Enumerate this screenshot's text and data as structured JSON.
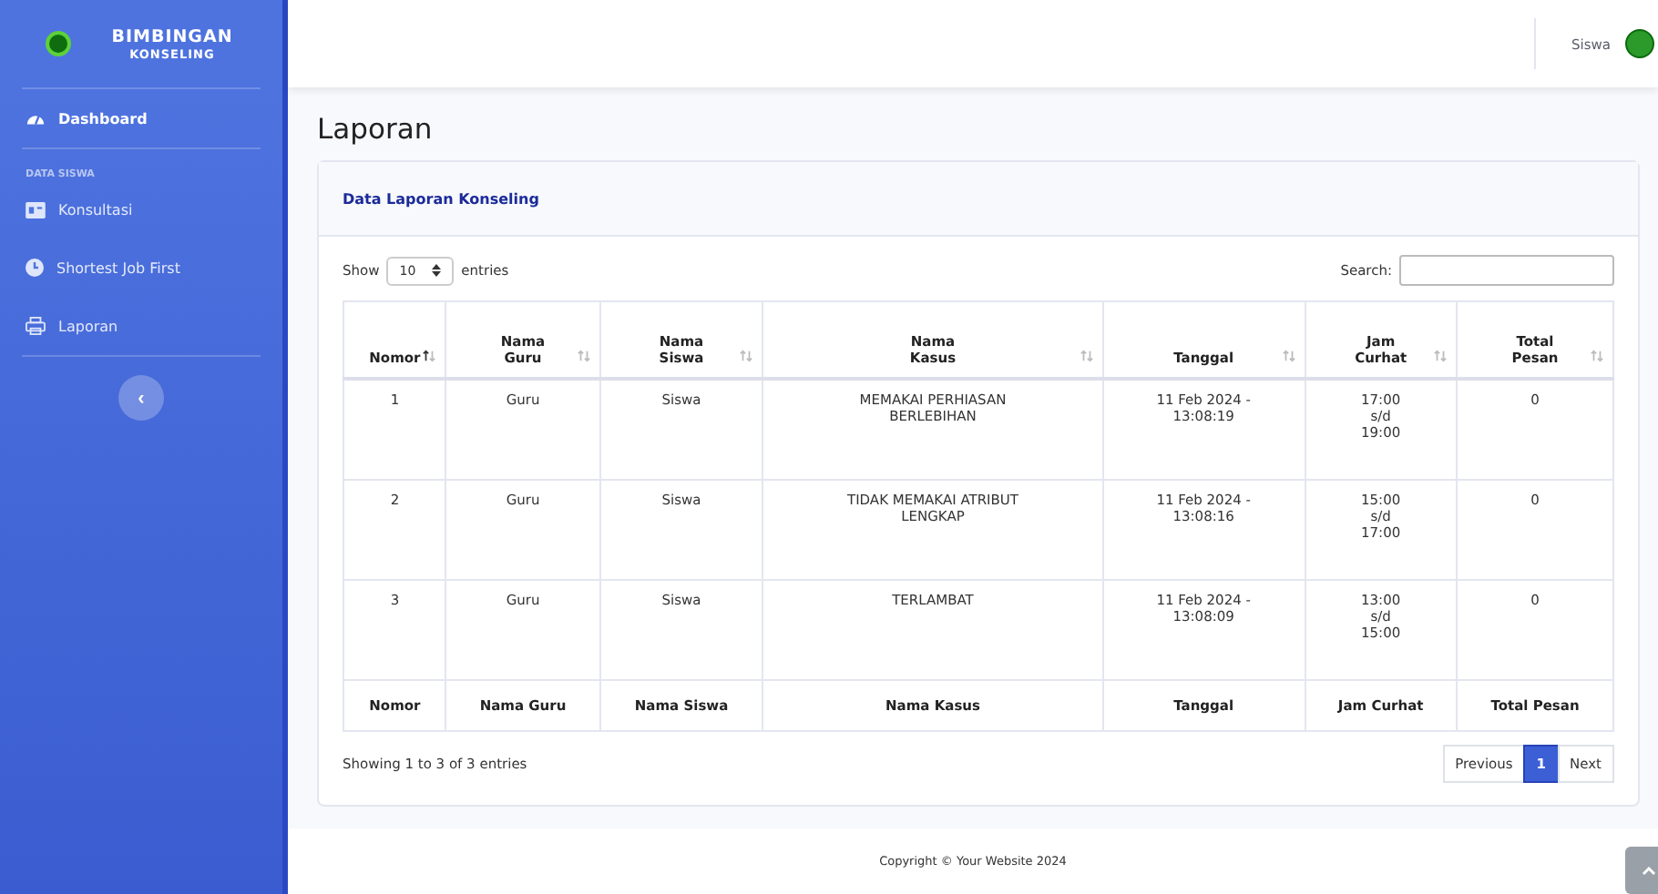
{
  "sidebar": {
    "brand": [
      "BIMBINGAN",
      "KONSELING"
    ],
    "items": [
      {
        "kind": "link",
        "label": "Dashboard",
        "selected": true
      },
      {
        "kind": "heading",
        "label": "DATA SISWA"
      },
      {
        "kind": "link",
        "label": "Konsultasi",
        "selected": false
      },
      {
        "kind": "link",
        "label": "Shortest Job First",
        "selected": false
      },
      {
        "kind": "link",
        "label": "Laporan",
        "selected": false
      }
    ],
    "toggle": "‹"
  },
  "topbar": {
    "user": "Siswa"
  },
  "page_title": "Laporan",
  "card": {
    "title": "Data Laporan Konseling",
    "show_label": "Show",
    "page_size": "10",
    "entries_label": "entries",
    "search_label": "Search:",
    "columns": [
      {
        "label": "Nomor",
        "sorted": true
      },
      {
        "label": "Nama Guru",
        "sorted": false
      },
      {
        "label": "Nama Siswa",
        "sorted": false
      },
      {
        "label": "Nama Kasus",
        "sorted": false
      },
      {
        "label": "Tanggal",
        "sorted": false
      },
      {
        "label": "Jam Curhat",
        "sorted": false
      },
      {
        "label": "Total Pesan",
        "sorted": false
      }
    ],
    "rows": [
      [
        "1",
        "Guru",
        "Siswa",
        "MEMAKAI PERHIASAN BERLEBIHAN",
        "11 Feb 2024 - 13:08:19",
        "17:00 s/d 19:00",
        "0"
      ],
      [
        "2",
        "Guru",
        "Siswa",
        "TIDAK MEMAKAI ATRIBUT LENGKAP",
        "11 Feb 2024 - 13:08:16",
        "15:00 s/d 17:00",
        "0"
      ],
      [
        "3",
        "Guru",
        "Siswa",
        "TERLAMBAT",
        "11 Feb 2024 - 13:08:09",
        "13:00 s/d 15:00",
        "0"
      ]
    ],
    "footer_columns": [
      "Nomor",
      "Nama Guru",
      "Nama Siswa",
      "Nama Kasus",
      "Tanggal",
      "Jam Curhat",
      "Total Pesan"
    ],
    "info": "Showing 1 to 3 of 3 entries",
    "pages": [
      {
        "label": "Previous",
        "selected": false
      },
      {
        "label": "1",
        "selected": true
      },
      {
        "label": "Next",
        "selected": false
      }
    ]
  },
  "footer": {
    "copyright": "Copyright © Your Website 2024"
  }
}
